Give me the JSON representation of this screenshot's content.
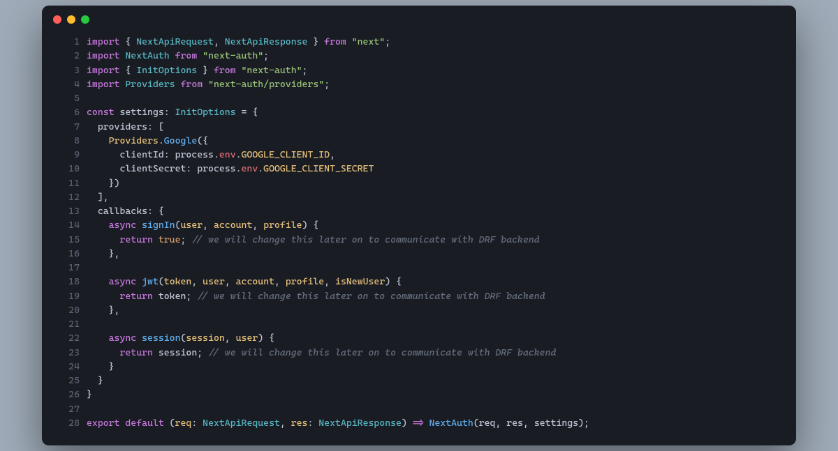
{
  "window": {
    "buttons": [
      "close",
      "minimize",
      "maximize"
    ]
  },
  "code": {
    "lines": [
      {
        "num": "1",
        "tokens": [
          {
            "t": "import",
            "c": "kw"
          },
          {
            "t": " { ",
            "c": "punc"
          },
          {
            "t": "NextApiRequest",
            "c": "type"
          },
          {
            "t": ", ",
            "c": "punc"
          },
          {
            "t": "NextApiResponse",
            "c": "type"
          },
          {
            "t": " } ",
            "c": "punc"
          },
          {
            "t": "from",
            "c": "kw"
          },
          {
            "t": " ",
            "c": "punc"
          },
          {
            "t": "\"next\"",
            "c": "str"
          },
          {
            "t": ";",
            "c": "punc"
          }
        ]
      },
      {
        "num": "2",
        "tokens": [
          {
            "t": "import",
            "c": "kw"
          },
          {
            "t": " ",
            "c": "punc"
          },
          {
            "t": "NextAuth",
            "c": "type"
          },
          {
            "t": " ",
            "c": "punc"
          },
          {
            "t": "from",
            "c": "kw"
          },
          {
            "t": " ",
            "c": "punc"
          },
          {
            "t": "\"next-auth\"",
            "c": "str"
          },
          {
            "t": ";",
            "c": "punc"
          }
        ]
      },
      {
        "num": "3",
        "tokens": [
          {
            "t": "import",
            "c": "kw"
          },
          {
            "t": " { ",
            "c": "punc"
          },
          {
            "t": "InitOptions",
            "c": "type"
          },
          {
            "t": " } ",
            "c": "punc"
          },
          {
            "t": "from",
            "c": "kw"
          },
          {
            "t": " ",
            "c": "punc"
          },
          {
            "t": "\"next-auth\"",
            "c": "str"
          },
          {
            "t": ";",
            "c": "punc"
          }
        ]
      },
      {
        "num": "4",
        "tokens": [
          {
            "t": "import",
            "c": "kw"
          },
          {
            "t": " ",
            "c": "punc"
          },
          {
            "t": "Providers",
            "c": "type"
          },
          {
            "t": " ",
            "c": "punc"
          },
          {
            "t": "from",
            "c": "kw"
          },
          {
            "t": " ",
            "c": "punc"
          },
          {
            "t": "\"next-auth/providers\"",
            "c": "str"
          },
          {
            "t": ";",
            "c": "punc"
          }
        ]
      },
      {
        "num": "5",
        "tokens": []
      },
      {
        "num": "6",
        "tokens": [
          {
            "t": "const",
            "c": "kw"
          },
          {
            "t": " ",
            "c": "punc"
          },
          {
            "t": "settings",
            "c": "prop"
          },
          {
            "t": ": ",
            "c": "punc"
          },
          {
            "t": "InitOptions",
            "c": "type"
          },
          {
            "t": " = {",
            "c": "punc"
          }
        ]
      },
      {
        "num": "7",
        "tokens": [
          {
            "t": "  ",
            "c": "punc"
          },
          {
            "t": "providers",
            "c": "prop"
          },
          {
            "t": ": [",
            "c": "punc"
          }
        ]
      },
      {
        "num": "8",
        "tokens": [
          {
            "t": "    ",
            "c": "punc"
          },
          {
            "t": "Providers",
            "c": "objname"
          },
          {
            "t": ".",
            "c": "punc"
          },
          {
            "t": "Google",
            "c": "fn"
          },
          {
            "t": "({",
            "c": "punc"
          }
        ]
      },
      {
        "num": "9",
        "tokens": [
          {
            "t": "      ",
            "c": "punc"
          },
          {
            "t": "clientId",
            "c": "prop"
          },
          {
            "t": ": ",
            "c": "punc"
          },
          {
            "t": "process",
            "c": "attr2"
          },
          {
            "t": ".",
            "c": "punc"
          },
          {
            "t": "env",
            "c": "attr"
          },
          {
            "t": ".",
            "c": "punc"
          },
          {
            "t": "GOOGLE_CLIENT_ID",
            "c": "env"
          },
          {
            "t": ",",
            "c": "punc"
          }
        ]
      },
      {
        "num": "10",
        "tokens": [
          {
            "t": "      ",
            "c": "punc"
          },
          {
            "t": "clientSecret",
            "c": "prop"
          },
          {
            "t": ": ",
            "c": "punc"
          },
          {
            "t": "process",
            "c": "attr2"
          },
          {
            "t": ".",
            "c": "punc"
          },
          {
            "t": "env",
            "c": "attr"
          },
          {
            "t": ".",
            "c": "punc"
          },
          {
            "t": "GOOGLE_CLIENT_SECRET",
            "c": "env"
          }
        ]
      },
      {
        "num": "11",
        "tokens": [
          {
            "t": "    })",
            "c": "punc"
          }
        ]
      },
      {
        "num": "12",
        "tokens": [
          {
            "t": "  ],",
            "c": "punc"
          }
        ]
      },
      {
        "num": "13",
        "tokens": [
          {
            "t": "  ",
            "c": "punc"
          },
          {
            "t": "callbacks",
            "c": "prop"
          },
          {
            "t": ": {",
            "c": "punc"
          }
        ]
      },
      {
        "num": "14",
        "tokens": [
          {
            "t": "    ",
            "c": "punc"
          },
          {
            "t": "async",
            "c": "kw"
          },
          {
            "t": " ",
            "c": "punc"
          },
          {
            "t": "signIn",
            "c": "fn"
          },
          {
            "t": "(",
            "c": "punc"
          },
          {
            "t": "user",
            "c": "param"
          },
          {
            "t": ", ",
            "c": "punc"
          },
          {
            "t": "account",
            "c": "param"
          },
          {
            "t": ", ",
            "c": "punc"
          },
          {
            "t": "profile",
            "c": "param"
          },
          {
            "t": ") {",
            "c": "punc"
          }
        ]
      },
      {
        "num": "15",
        "tokens": [
          {
            "t": "      ",
            "c": "punc"
          },
          {
            "t": "return",
            "c": "kw"
          },
          {
            "t": " ",
            "c": "punc"
          },
          {
            "t": "true",
            "c": "bool"
          },
          {
            "t": "; ",
            "c": "punc"
          },
          {
            "t": "// we will change this later on to communicate with DRF backend",
            "c": "comment"
          }
        ]
      },
      {
        "num": "16",
        "tokens": [
          {
            "t": "    },",
            "c": "punc"
          }
        ]
      },
      {
        "num": "17",
        "tokens": []
      },
      {
        "num": "18",
        "tokens": [
          {
            "t": "    ",
            "c": "punc"
          },
          {
            "t": "async",
            "c": "kw"
          },
          {
            "t": " ",
            "c": "punc"
          },
          {
            "t": "jwt",
            "c": "fn"
          },
          {
            "t": "(",
            "c": "punc"
          },
          {
            "t": "token",
            "c": "param"
          },
          {
            "t": ", ",
            "c": "punc"
          },
          {
            "t": "user",
            "c": "param"
          },
          {
            "t": ", ",
            "c": "punc"
          },
          {
            "t": "account",
            "c": "param"
          },
          {
            "t": ", ",
            "c": "punc"
          },
          {
            "t": "profile",
            "c": "param"
          },
          {
            "t": ", ",
            "c": "punc"
          },
          {
            "t": "isNewUser",
            "c": "param"
          },
          {
            "t": ") {",
            "c": "punc"
          }
        ]
      },
      {
        "num": "19",
        "tokens": [
          {
            "t": "      ",
            "c": "punc"
          },
          {
            "t": "return",
            "c": "kw"
          },
          {
            "t": " ",
            "c": "punc"
          },
          {
            "t": "token",
            "c": "prop"
          },
          {
            "t": "; ",
            "c": "punc"
          },
          {
            "t": "// we will change this later on to communicate with DRF backend",
            "c": "comment"
          }
        ]
      },
      {
        "num": "20",
        "tokens": [
          {
            "t": "    },",
            "c": "punc"
          }
        ]
      },
      {
        "num": "21",
        "tokens": []
      },
      {
        "num": "22",
        "tokens": [
          {
            "t": "    ",
            "c": "punc"
          },
          {
            "t": "async",
            "c": "kw"
          },
          {
            "t": " ",
            "c": "punc"
          },
          {
            "t": "session",
            "c": "fn"
          },
          {
            "t": "(",
            "c": "punc"
          },
          {
            "t": "session",
            "c": "param"
          },
          {
            "t": ", ",
            "c": "punc"
          },
          {
            "t": "user",
            "c": "param"
          },
          {
            "t": ") {",
            "c": "punc"
          }
        ]
      },
      {
        "num": "23",
        "tokens": [
          {
            "t": "      ",
            "c": "punc"
          },
          {
            "t": "return",
            "c": "kw"
          },
          {
            "t": " ",
            "c": "punc"
          },
          {
            "t": "session",
            "c": "prop"
          },
          {
            "t": "; ",
            "c": "punc"
          },
          {
            "t": "// we will change this later on to communicate with DRF backend",
            "c": "comment"
          }
        ]
      },
      {
        "num": "24",
        "tokens": [
          {
            "t": "    }",
            "c": "punc"
          }
        ]
      },
      {
        "num": "25",
        "tokens": [
          {
            "t": "  }",
            "c": "punc"
          }
        ]
      },
      {
        "num": "26",
        "tokens": [
          {
            "t": "}",
            "c": "punc"
          }
        ]
      },
      {
        "num": "27",
        "tokens": []
      },
      {
        "num": "28",
        "tokens": [
          {
            "t": "export",
            "c": "kw"
          },
          {
            "t": " ",
            "c": "punc"
          },
          {
            "t": "default",
            "c": "kw"
          },
          {
            "t": " (",
            "c": "punc"
          },
          {
            "t": "req",
            "c": "param"
          },
          {
            "t": ": ",
            "c": "punc"
          },
          {
            "t": "NextApiRequest",
            "c": "type"
          },
          {
            "t": ", ",
            "c": "punc"
          },
          {
            "t": "res",
            "c": "param"
          },
          {
            "t": ": ",
            "c": "punc"
          },
          {
            "t": "NextApiResponse",
            "c": "type"
          },
          {
            "t": ") ",
            "c": "punc"
          },
          {
            "t": "=>",
            "c": "arrow"
          },
          {
            "t": " ",
            "c": "punc"
          },
          {
            "t": "NextAuth",
            "c": "fn"
          },
          {
            "t": "(",
            "c": "punc"
          },
          {
            "t": "req",
            "c": "prop"
          },
          {
            "t": ", ",
            "c": "punc"
          },
          {
            "t": "res",
            "c": "prop"
          },
          {
            "t": ", ",
            "c": "punc"
          },
          {
            "t": "settings",
            "c": "prop"
          },
          {
            "t": ");",
            "c": "punc"
          }
        ]
      }
    ]
  }
}
